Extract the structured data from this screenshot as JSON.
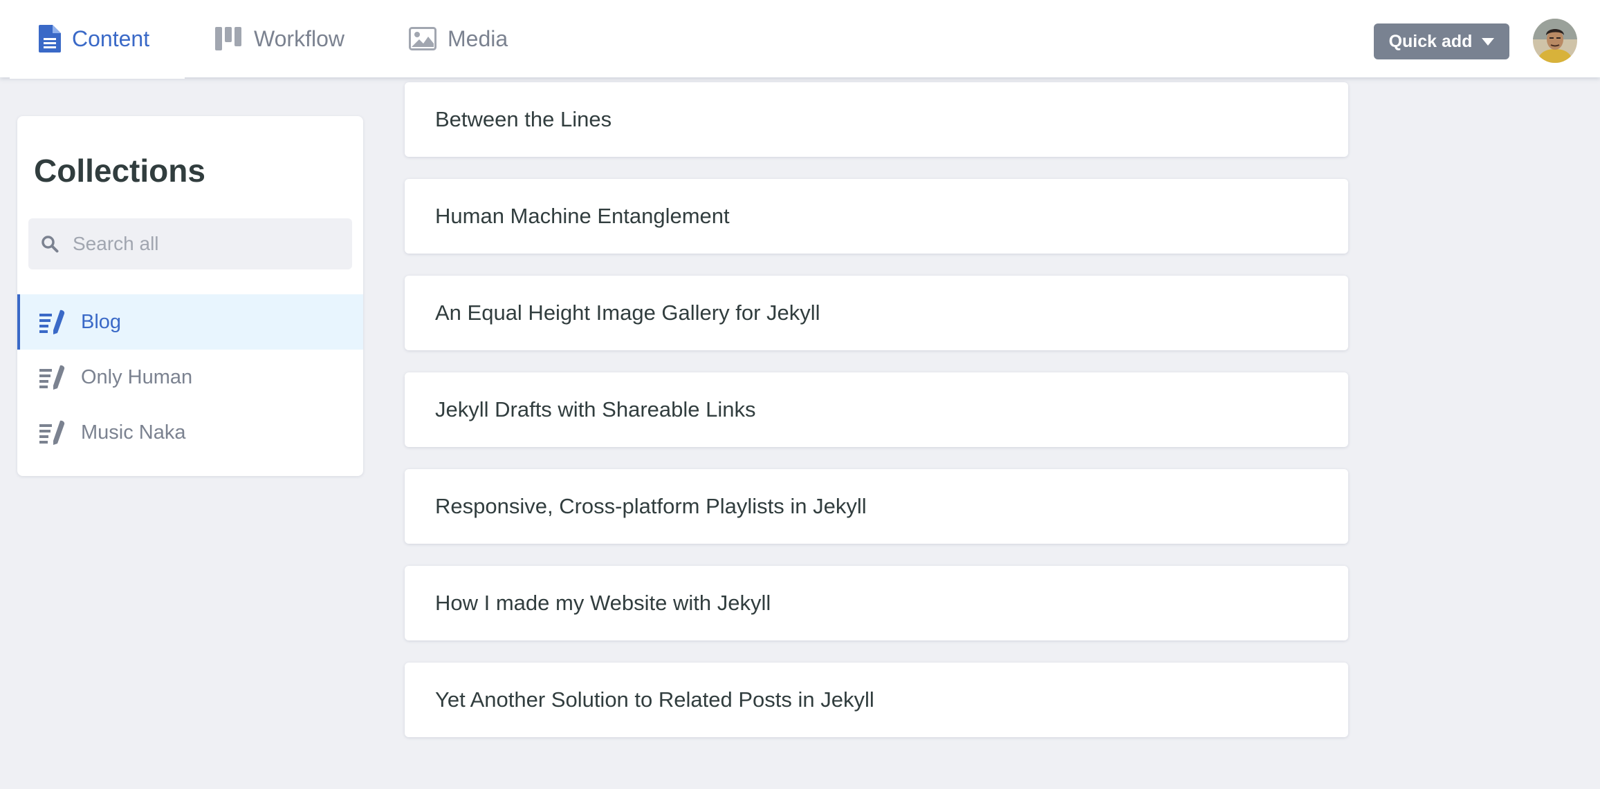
{
  "header": {
    "tabs": [
      {
        "label": "Content",
        "icon": "document-icon",
        "active": true
      },
      {
        "label": "Workflow",
        "icon": "workflow-columns-icon",
        "active": false
      },
      {
        "label": "Media",
        "icon": "image-icon",
        "active": false
      }
    ],
    "quick_add_label": "Quick add"
  },
  "sidebar": {
    "title": "Collections",
    "search_placeholder": "Search all",
    "items": [
      {
        "label": "Blog",
        "icon": "write-icon",
        "active": true
      },
      {
        "label": "Only Human",
        "icon": "write-icon",
        "active": false
      },
      {
        "label": "Music Naka",
        "icon": "write-icon",
        "active": false
      }
    ]
  },
  "entries": [
    {
      "title": "Between the Lines"
    },
    {
      "title": "Human Machine Entanglement"
    },
    {
      "title": "An Equal Height Image Gallery for Jekyll"
    },
    {
      "title": "Jekyll Drafts with Shareable Links"
    },
    {
      "title": "Responsive, Cross-platform Playlists in Jekyll"
    },
    {
      "title": "How I made my Website with Jekyll"
    },
    {
      "title": "Yet Another Solution to Related Posts in Jekyll"
    }
  ],
  "colors": {
    "accent": "#3a69c7",
    "text": "#313d3e",
    "muted": "#7b8290",
    "background": "#eff0f4",
    "active_bg": "#e8f5fe",
    "button": "#798291"
  }
}
